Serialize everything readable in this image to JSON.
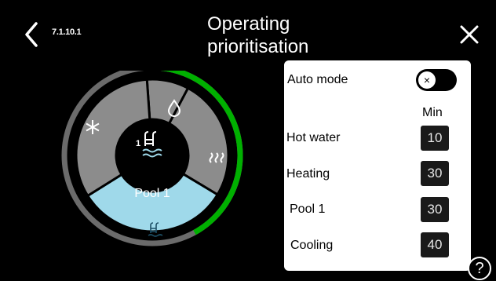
{
  "header": {
    "menu_code": "7.1.10.1",
    "title": "Operating prioritisation",
    "back_icon": "chevron-left-icon",
    "close_icon": "close-icon"
  },
  "dial": {
    "center_label": "Pool 1",
    "active_segment": "pool",
    "segments": [
      {
        "name": "hot-water",
        "icon": "water-drop-icon"
      },
      {
        "name": "heating",
        "icon": "heating-icon"
      },
      {
        "name": "pool",
        "icon": "pool-icon"
      },
      {
        "name": "cooling",
        "icon": "snowflake-icon"
      }
    ],
    "center_icon": "pool-1-icon",
    "progress_fraction": 0.42,
    "colors": {
      "segment": "#8c8c8c",
      "active_segment": "#9fd9ea",
      "progress": "#00b000",
      "outer_ring": "#6b6b6b"
    }
  },
  "panel": {
    "auto_mode_label": "Auto mode",
    "auto_mode_on": false,
    "min_header": "Min",
    "rows": [
      {
        "label": "Hot water",
        "value": "10"
      },
      {
        "label": "Heating",
        "value": "30"
      },
      {
        "label": "Pool 1",
        "value": "30"
      },
      {
        "label": "Cooling",
        "value": "40"
      }
    ]
  },
  "help": {
    "label": "?"
  }
}
